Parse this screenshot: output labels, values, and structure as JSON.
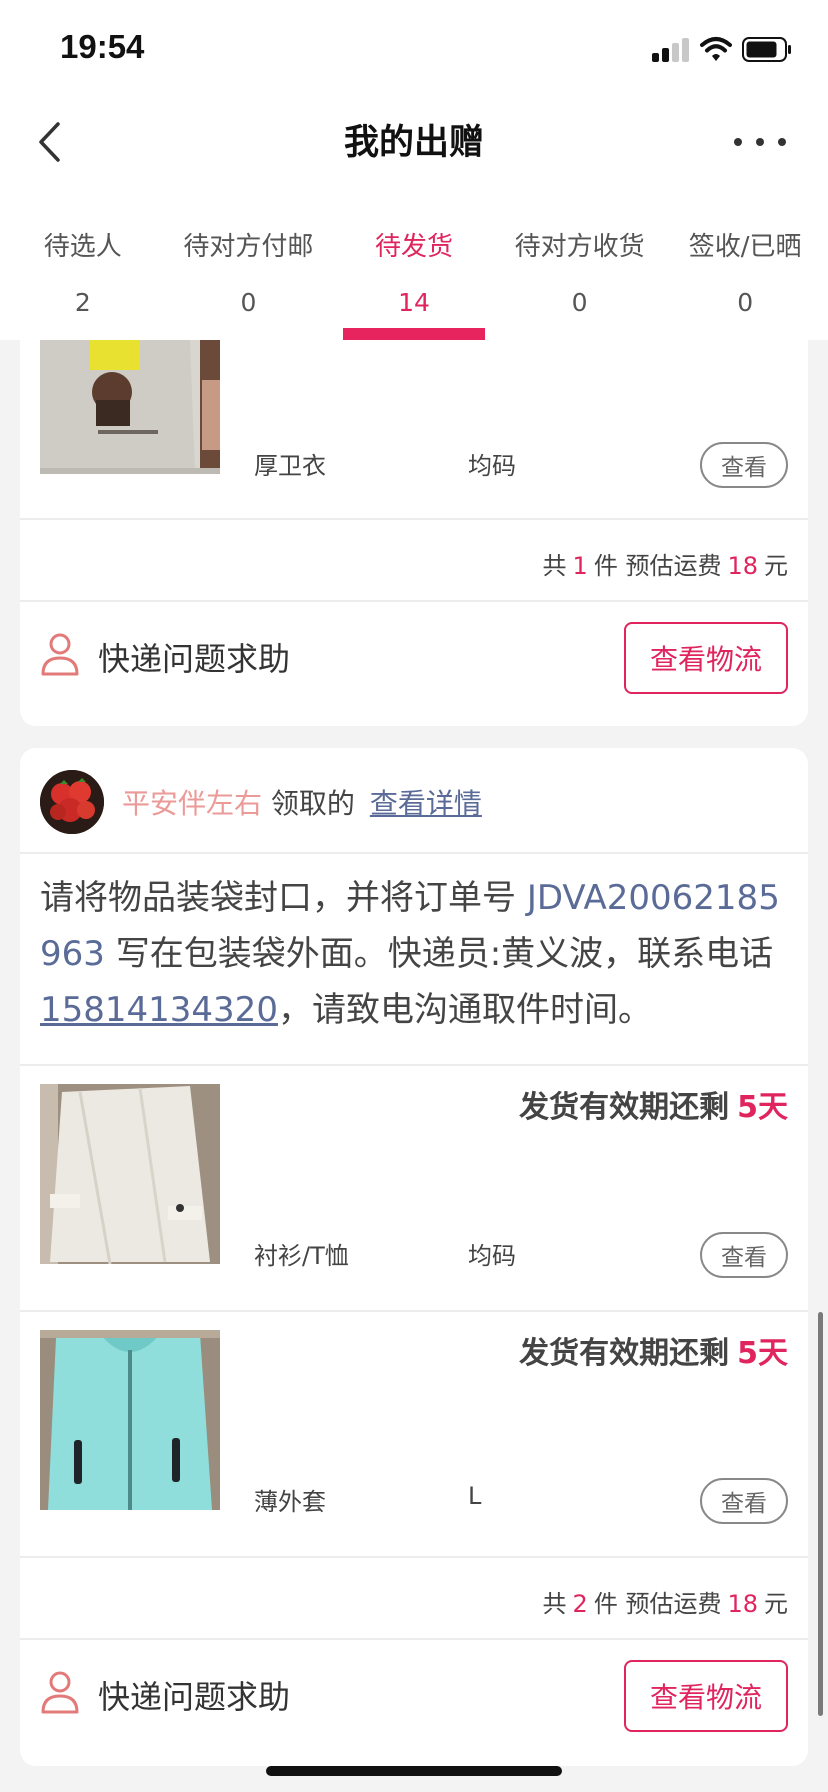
{
  "status_bar": {
    "time": "19:54"
  },
  "nav": {
    "title": "我的出赠"
  },
  "tabs": [
    {
      "label": "待选人",
      "count": "2"
    },
    {
      "label": "待对方付邮",
      "count": "0"
    },
    {
      "label": "待发货",
      "count": "14",
      "active": true
    },
    {
      "label": "待对方收货",
      "count": "0"
    },
    {
      "label": "签收/已晒",
      "count": "0"
    }
  ],
  "card1": {
    "item": {
      "category": "厚卫衣",
      "size": "均码",
      "view_label": "查看"
    },
    "summary": {
      "prefix": "共",
      "count": "1",
      "unit": "件 预估运费",
      "fee": "18",
      "currency": "元"
    },
    "help_label": "快递问题求助",
    "logistics_label": "查看物流"
  },
  "card2": {
    "receiver": {
      "name": "平安伴左右",
      "action": "领取的",
      "detail_link": "查看详情"
    },
    "instruction": {
      "part1": "请将物品装袋封口，并将订单号 ",
      "order_no": "JDVA20062185963",
      "part2": " 写在包装袋外面。快递员:黄义波，联系电话",
      "phone": "15814134320",
      "part3": "，请致电沟通取件时间。"
    },
    "items": [
      {
        "deadline_label": "发货有效期还剩",
        "deadline_days": "5天",
        "category": "衬衫/T恤",
        "size": "均码",
        "view_label": "查看"
      },
      {
        "deadline_label": "发货有效期还剩",
        "deadline_days": "5天",
        "category": "薄外套",
        "size": "L",
        "view_label": "查看"
      }
    ],
    "summary": {
      "prefix": "共",
      "count": "2",
      "unit": "件 预估运费",
      "fee": "18",
      "currency": "元"
    },
    "help_label": "快递问题求助",
    "logistics_label": "查看物流"
  },
  "colors": {
    "accent": "#e0245e",
    "link": "#5a6b97",
    "receiver_name": "#eb9a98"
  }
}
